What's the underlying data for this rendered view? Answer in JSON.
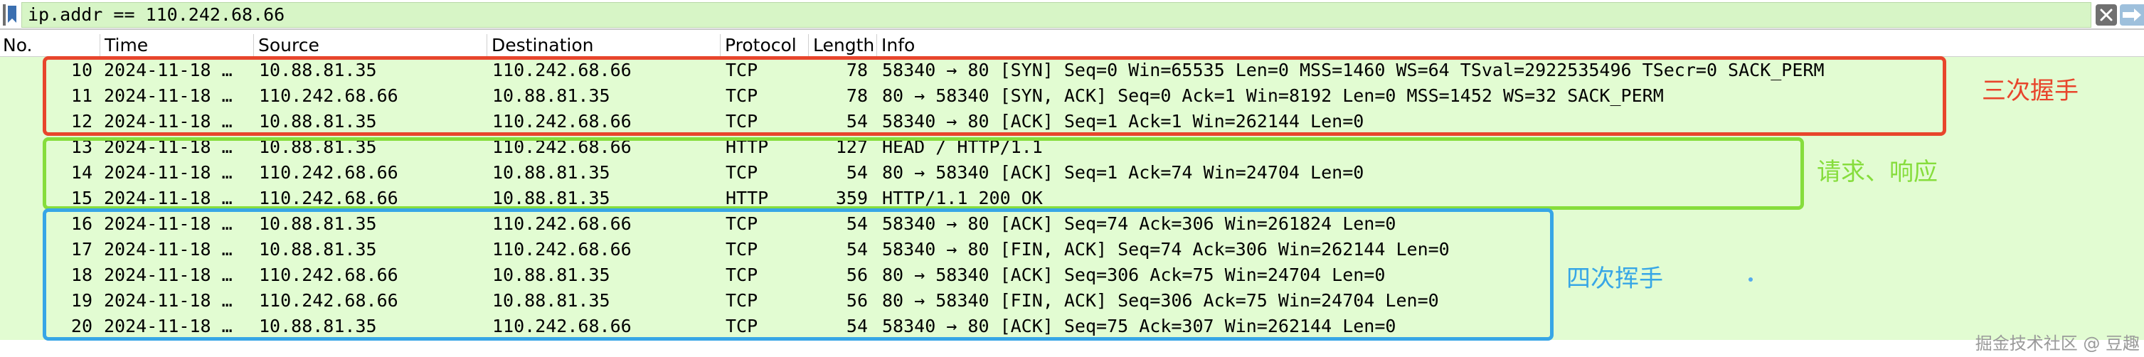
{
  "filter": {
    "value": "ip.addr == 110.242.68.66"
  },
  "columns": [
    "No.",
    "Time",
    "Source",
    "Destination",
    "Protocol",
    "Length",
    "Info"
  ],
  "packets": [
    {
      "no": "10",
      "time": "2024-11-18 …",
      "src": "10.88.81.35",
      "dst": "110.242.68.66",
      "proto": "TCP",
      "len": "78",
      "info": "58340 → 80 [SYN] Seq=0 Win=65535 Len=0 MSS=1460 WS=64 TSval=2922535496 TSecr=0 SACK_PERM"
    },
    {
      "no": "11",
      "time": "2024-11-18 …",
      "src": "110.242.68.66",
      "dst": "10.88.81.35",
      "proto": "TCP",
      "len": "78",
      "info": "80 → 58340 [SYN, ACK] Seq=0 Ack=1 Win=8192 Len=0 MSS=1452 WS=32 SACK_PERM"
    },
    {
      "no": "12",
      "time": "2024-11-18 …",
      "src": "10.88.81.35",
      "dst": "110.242.68.66",
      "proto": "TCP",
      "len": "54",
      "info": "58340 → 80 [ACK] Seq=1 Ack=1 Win=262144 Len=0"
    },
    {
      "no": "13",
      "time": "2024-11-18 …",
      "src": "10.88.81.35",
      "dst": "110.242.68.66",
      "proto": "HTTP",
      "len": "127",
      "info": "HEAD / HTTP/1.1"
    },
    {
      "no": "14",
      "time": "2024-11-18 …",
      "src": "110.242.68.66",
      "dst": "10.88.81.35",
      "proto": "TCP",
      "len": "54",
      "info": "80 → 58340 [ACK] Seq=1 Ack=74 Win=24704 Len=0"
    },
    {
      "no": "15",
      "time": "2024-11-18 …",
      "src": "110.242.68.66",
      "dst": "10.88.81.35",
      "proto": "HTTP",
      "len": "359",
      "info": "HTTP/1.1 200 OK"
    },
    {
      "no": "16",
      "time": "2024-11-18 …",
      "src": "10.88.81.35",
      "dst": "110.242.68.66",
      "proto": "TCP",
      "len": "54",
      "info": "58340 → 80 [ACK] Seq=74 Ack=306 Win=261824 Len=0"
    },
    {
      "no": "17",
      "time": "2024-11-18 …",
      "src": "10.88.81.35",
      "dst": "110.242.68.66",
      "proto": "TCP",
      "len": "54",
      "info": "58340 → 80 [FIN, ACK] Seq=74 Ack=306 Win=262144 Len=0"
    },
    {
      "no": "18",
      "time": "2024-11-18 …",
      "src": "110.242.68.66",
      "dst": "10.88.81.35",
      "proto": "TCP",
      "len": "56",
      "info": "80 → 58340 [ACK] Seq=306 Ack=75 Win=24704 Len=0"
    },
    {
      "no": "19",
      "time": "2024-11-18 …",
      "src": "110.242.68.66",
      "dst": "10.88.81.35",
      "proto": "TCP",
      "len": "56",
      "info": "80 → 58340 [FIN, ACK] Seq=306 Ack=75 Win=24704 Len=0"
    },
    {
      "no": "20",
      "time": "2024-11-18 …",
      "src": "10.88.81.35",
      "dst": "110.242.68.66",
      "proto": "TCP",
      "len": "54",
      "info": "58340 → 80 [ACK] Seq=75 Ack=307 Win=262144 Len=0"
    }
  ],
  "annotations": [
    {
      "label": "三次握手",
      "color": "#e8452c"
    },
    {
      "label": "请求、响应",
      "color": "#86dd3c"
    },
    {
      "label": "四次挥手",
      "color": "#37a6e6"
    }
  ],
  "watermark": "掘金技术社区 @ 豆趣",
  "colors": {
    "row_background": "#e2fcd2",
    "filter_valid": "#d7f5c6"
  }
}
